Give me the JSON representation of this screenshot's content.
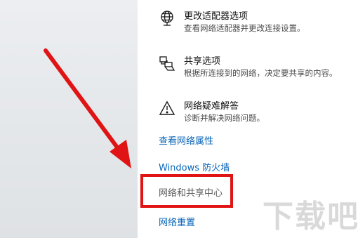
{
  "options": [
    {
      "title": "更改适配器选项",
      "desc": "查看网络适配器并更改连接设置。",
      "icon": "globe-icon"
    },
    {
      "title": "共享选项",
      "desc": "根据所连接到的网络，决定要共享的内容。",
      "icon": "sharing-icon"
    },
    {
      "title": "网络疑难解答",
      "desc": "诊断并解决网络问题。",
      "icon": "warning-icon"
    }
  ],
  "links": {
    "view_properties": "查看网络属性",
    "firewall": "Windows 防火墙",
    "sharing_center": "网络和共享中心",
    "reset": "网络重置"
  },
  "watermark": "下载吧",
  "colors": {
    "link": "#0b66b8",
    "highlight": "#e01414",
    "arrow": "#e01414"
  }
}
